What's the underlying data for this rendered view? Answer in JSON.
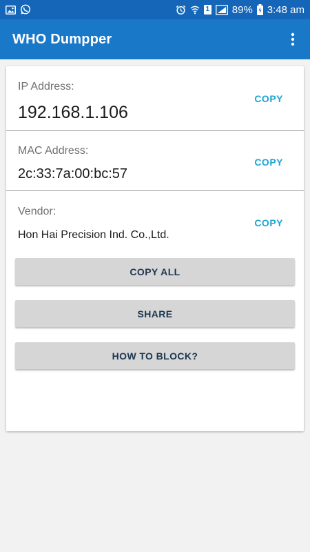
{
  "status_bar": {
    "battery_percent": "89%",
    "time": "3:48 am",
    "sim_slot": "1",
    "icons": [
      "gallery-icon",
      "whatsapp-icon",
      "alarm-icon",
      "wifi-icon",
      "sim-1-icon",
      "signal-icon",
      "battery-charging-icon"
    ]
  },
  "app_bar": {
    "title": "WHO Dumpper",
    "menu_icon": "more-vert-icon"
  },
  "fields": {
    "ip": {
      "label": "IP Address:",
      "value": "192.168.1.106",
      "copy_label": "COPY"
    },
    "mac": {
      "label": "MAC Address:",
      "value": "2c:33:7a:00:bc:57",
      "copy_label": "COPY"
    },
    "vendor": {
      "label": "Vendor:",
      "value": "Hon Hai Precision Ind. Co.,Ltd.",
      "copy_label": "COPY"
    }
  },
  "actions": {
    "copy_all": "COPY ALL",
    "share": "SHARE",
    "how_to_block": "HOW TO BLOCK?"
  },
  "colors": {
    "status_bar": "#1566b8",
    "app_bar": "#1a78c9",
    "accent_copy": "#1ba5d4",
    "button_bg": "#d6d6d6",
    "button_text": "#1c3550"
  }
}
